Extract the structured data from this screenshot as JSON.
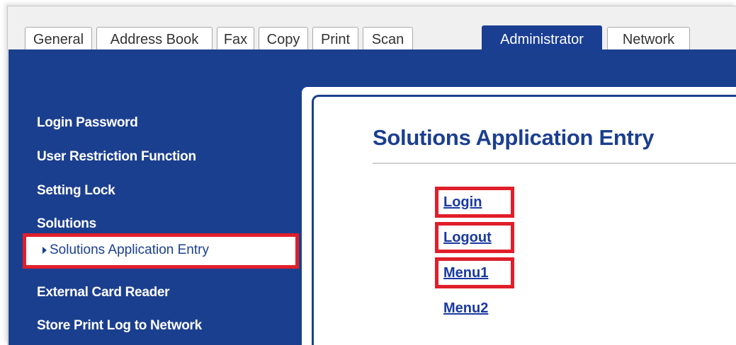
{
  "tabs": [
    {
      "label": "General"
    },
    {
      "label": "Address Book"
    },
    {
      "label": "Fax"
    },
    {
      "label": "Copy"
    },
    {
      "label": "Print"
    },
    {
      "label": "Scan"
    },
    {
      "label": "Administrator",
      "active": true
    },
    {
      "label": "Network"
    }
  ],
  "sidebar": {
    "items": [
      {
        "label": "Login Password"
      },
      {
        "label": "User Restriction Function"
      },
      {
        "label": "Setting Lock"
      },
      {
        "label": "Solutions"
      },
      {
        "label": "Solutions Application Entry",
        "selected": true
      },
      {
        "label": "External Card Reader"
      },
      {
        "label": "Store Print Log to Network"
      }
    ]
  },
  "main": {
    "title": "Solutions Application Entry",
    "links": [
      {
        "label": "Login"
      },
      {
        "label": "Logout"
      },
      {
        "label": "Menu1"
      },
      {
        "label": "Menu2"
      }
    ]
  },
  "colors": {
    "brand_blue": "#1b3f8f",
    "highlight_red": "#e01f2a",
    "link_blue": "#1a3aa0"
  }
}
